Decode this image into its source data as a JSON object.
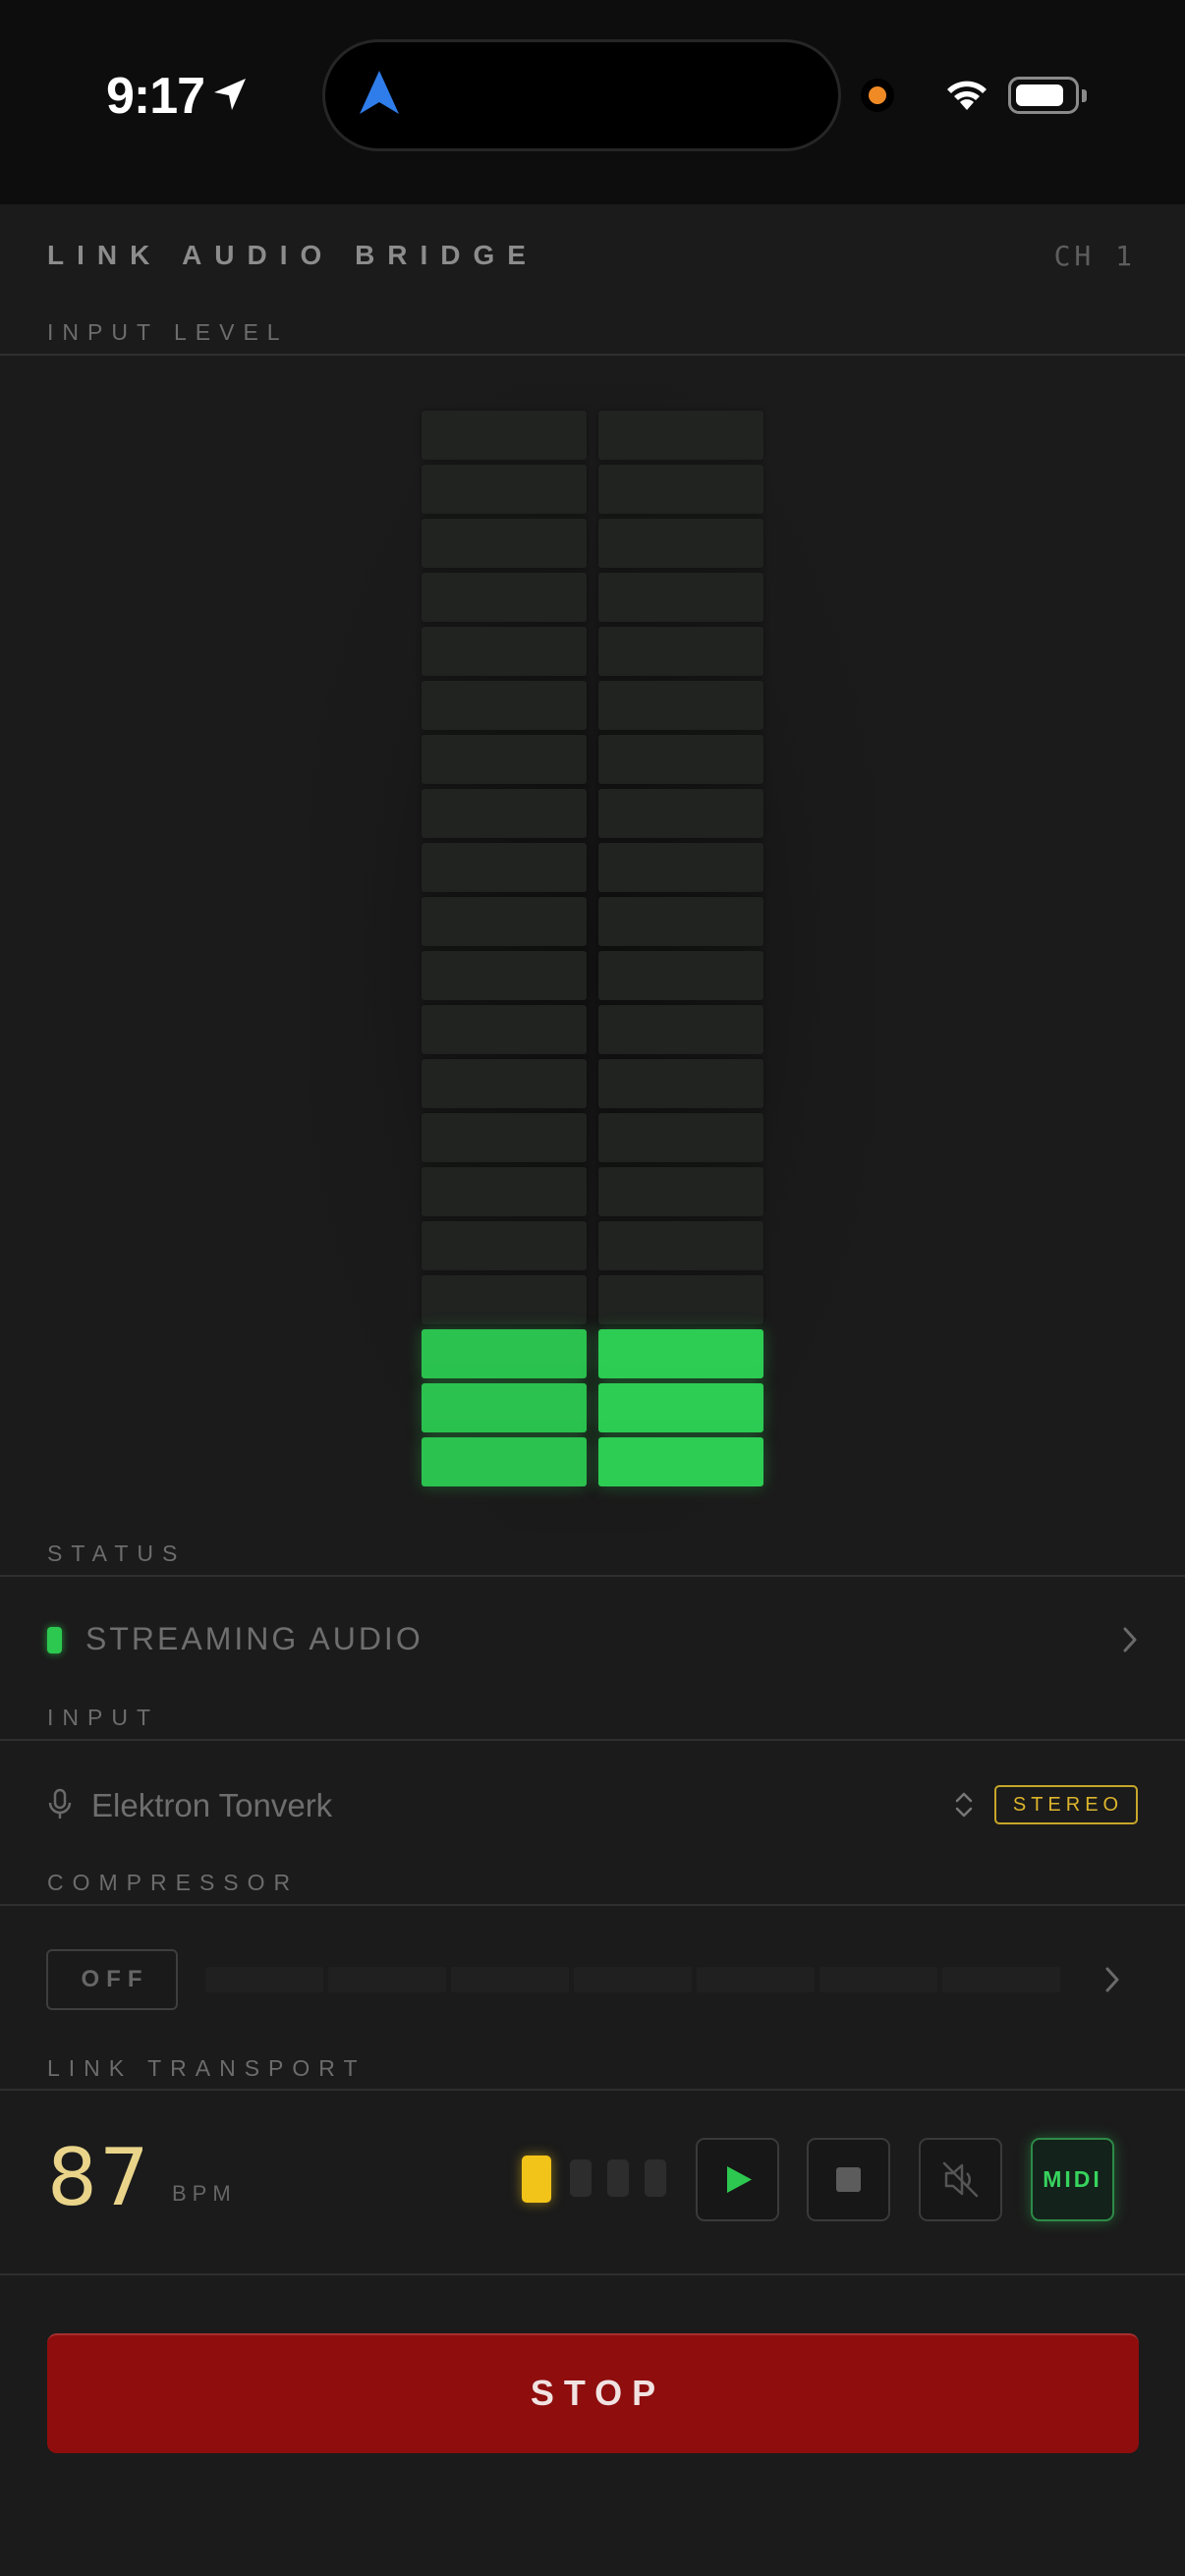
{
  "status_bar": {
    "time": "9:17"
  },
  "header": {
    "title": "LINK AUDIO BRIDGE",
    "channel": "CH 1"
  },
  "input_level": {
    "label": "INPUT LEVEL",
    "segments_total": 20,
    "left_lit_segments": 3,
    "right_lit_segments": 3,
    "lit_color": "#2bc24f"
  },
  "status": {
    "label": "STATUS",
    "text": "STREAMING AUDIO",
    "led_color": "#2dc84f"
  },
  "input": {
    "label": "INPUT",
    "device": "Elektron Tonverk",
    "mode_badge": "STEREO"
  },
  "compressor": {
    "label": "COMPRESSOR",
    "toggle": "OFF",
    "gain_reduction_segments": 7
  },
  "transport": {
    "label": "LINK TRANSPORT",
    "bpm": "87",
    "bpm_unit": "BPM",
    "beats": 4,
    "active_beat": 1,
    "midi_label": "MIDI"
  },
  "stop_button": {
    "label": "STOP",
    "color": "#8f0d0d"
  }
}
